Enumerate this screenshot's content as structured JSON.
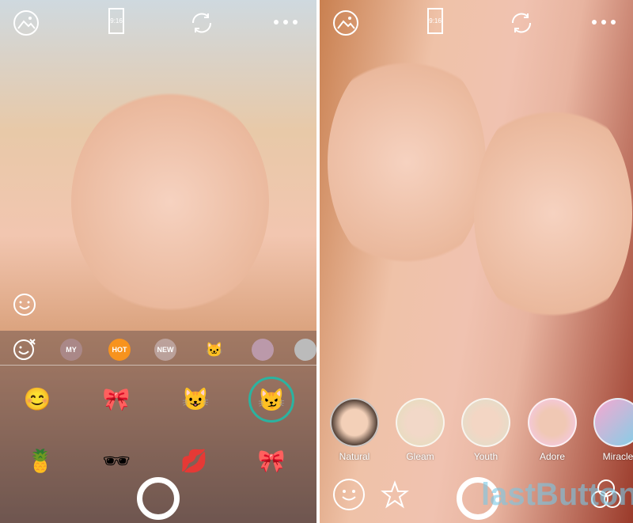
{
  "left_screen": {
    "top_bar": {
      "gallery_icon": "image-icon",
      "aspect_ratio": "9:16",
      "switch_camera_icon": "rotate-icon",
      "more_icon": "ellipsis-icon"
    },
    "side_icons": [
      "face-sparkle-icon"
    ],
    "sticker_tabs": [
      {
        "label": "",
        "icon": "face-remove-icon"
      },
      {
        "label": "MY",
        "icon": "star-badge"
      },
      {
        "label": "HOT",
        "icon": "sun-badge",
        "color": "#f7931e",
        "active": true
      },
      {
        "label": "NEW",
        "icon": "circle-badge"
      },
      {
        "label": "",
        "icon": "cat-whiskers-thumb"
      },
      {
        "label": "",
        "icon": "lion-thumb"
      },
      {
        "label": "",
        "icon": "cat-thumb"
      }
    ],
    "stickers": [
      "emoji-swap",
      "bow-whiskers",
      "cat-whiskers-blue",
      "cat-ears-red",
      "pineapple",
      "sunglasses",
      "lips",
      "polka-bow"
    ],
    "selected_sticker_color": "#2bb3a0"
  },
  "right_screen": {
    "top_bar": {
      "gallery_icon": "image-icon",
      "aspect_ratio": "9:16",
      "switch_camera_icon": "rotate-icon",
      "more_icon": "ellipsis-icon"
    },
    "filters": [
      {
        "label": "Natural"
      },
      {
        "label": "Gleam"
      },
      {
        "label": "Youth"
      },
      {
        "label": "Adore"
      },
      {
        "label": "Miracle"
      }
    ],
    "bottom_icons": [
      "face-icon",
      "sparkle-star-icon",
      "shutter",
      "filters-circles-icon"
    ]
  },
  "watermark": "lastButton.ru"
}
